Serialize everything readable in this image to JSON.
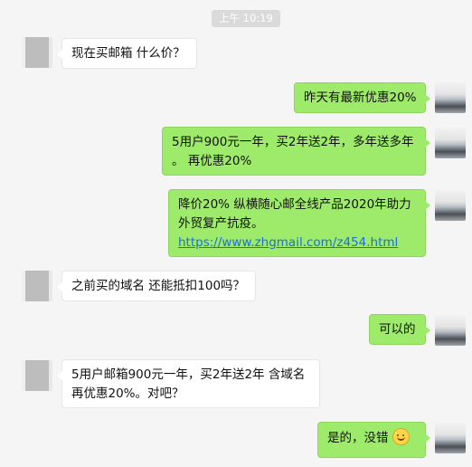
{
  "timestamp": "上午 10:19",
  "messages": [
    {
      "side": "left",
      "lines": [
        "现在买邮箱 什么价？"
      ]
    },
    {
      "side": "right",
      "lines": [
        "昨天有最新优惠20%"
      ]
    },
    {
      "side": "right",
      "lines": [
        "5用户900元一年，买2年送2年，多年送多年",
        "。  再优惠20%"
      ]
    },
    {
      "side": "right",
      "lines": [
        "降价20%  纵横随心邮全线产品2020年助力",
        "外贸复产抗疫。"
      ],
      "link": "https://www.zhgmail.com/z454.html"
    },
    {
      "side": "left",
      "lines": [
        "之前买的域名 还能抵扣100吗？"
      ]
    },
    {
      "side": "right",
      "lines": [
        "可以的"
      ]
    },
    {
      "side": "left",
      "lines": [
        "5用户邮箱900元一年，买2年送2年 含域名",
        "再优惠20%。对吧？"
      ]
    },
    {
      "side": "right",
      "lines": [
        "是的，没错"
      ],
      "emoji": "smiling-face-icon"
    }
  ]
}
